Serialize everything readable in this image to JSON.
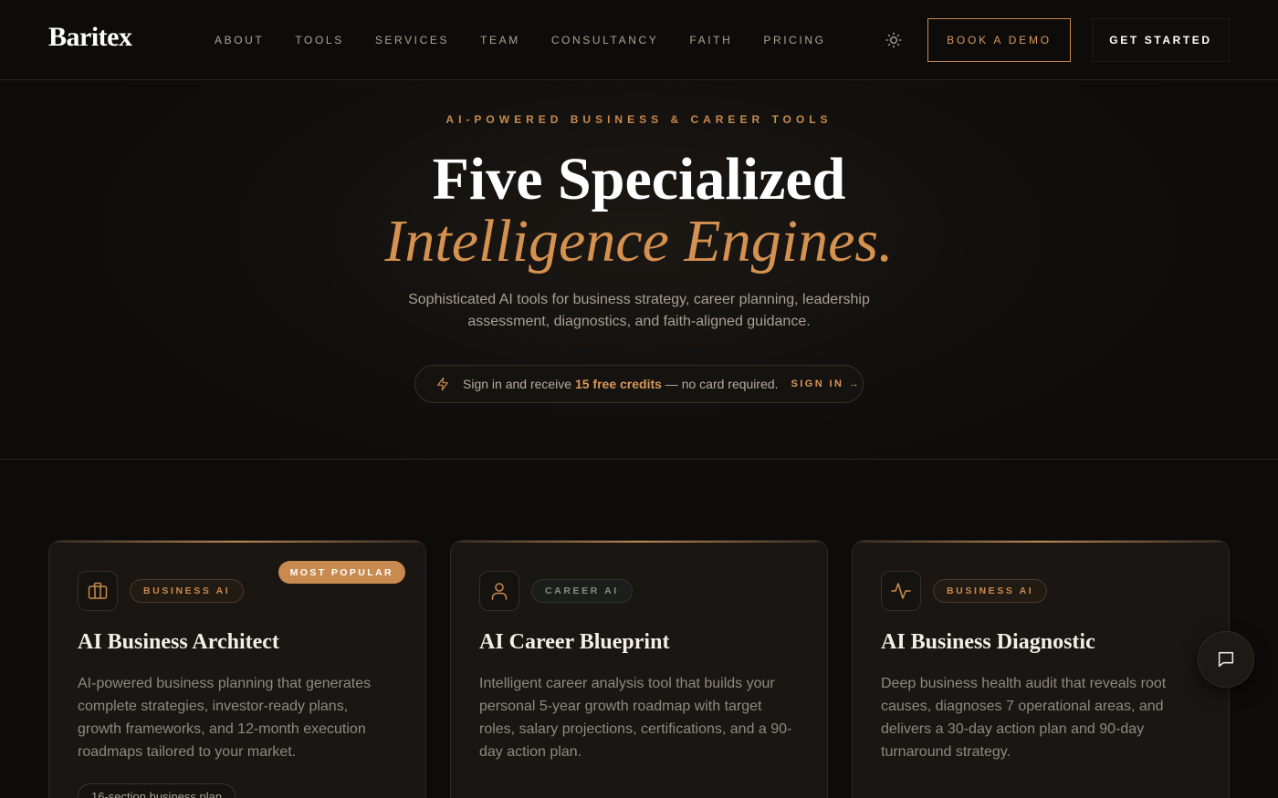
{
  "brand": {
    "logo": "Baritex"
  },
  "nav": {
    "links": [
      "ABOUT",
      "TOOLS",
      "SERVICES",
      "TEAM",
      "CONSULTANCY",
      "FAITH",
      "PRICING"
    ],
    "theme_icon": "sun-icon",
    "demo_label": "BOOK A DEMO",
    "start_label": "GET STARTED"
  },
  "hero": {
    "eyebrow": "AI-POWERED BUSINESS & CAREER TOOLS",
    "title_line1": "Five Specialized",
    "title_line2": "Intelligence Engines.",
    "subtitle": "Sophisticated AI tools for business strategy, career planning, leadership assessment, diagnostics, and faith-aligned guidance.",
    "credits": {
      "icon": "lightning-icon",
      "text_before": "Sign in and receive ",
      "highlight": "15 free credits",
      "text_after": " — no card required.",
      "signin_label": "SIGN IN →"
    }
  },
  "cards": [
    {
      "icon": "briefcase-icon",
      "tag": "BUSINESS AI",
      "badge": "MOST POPULAR",
      "title": "AI Business Architect",
      "description": "AI-powered business planning that generates complete strategies, investor-ready plans, growth frameworks, and 12-month execution roadmaps tailored to your market.",
      "feature": "16-section business plan"
    },
    {
      "icon": "person-icon",
      "tag": "CAREER AI",
      "title": "AI Career Blueprint",
      "description": "Intelligent career analysis tool that builds your personal 5-year growth roadmap with target roles, salary projections, certifications, and a 90-day action plan."
    },
    {
      "icon": "pulse-icon",
      "tag": "BUSINESS AI",
      "title": "AI Business Diagnostic",
      "description": "Deep business health audit that reveals root causes, diagnoses 7 operational areas, and delivers a 30-day action plan and 90-day turnaround strategy."
    }
  ],
  "chat": {
    "icon": "chat-bubble-icon"
  },
  "colors": {
    "background": "#0d0c0b",
    "accent": "#c88a4e",
    "card": "#191613",
    "text_muted": "#8f897f"
  }
}
